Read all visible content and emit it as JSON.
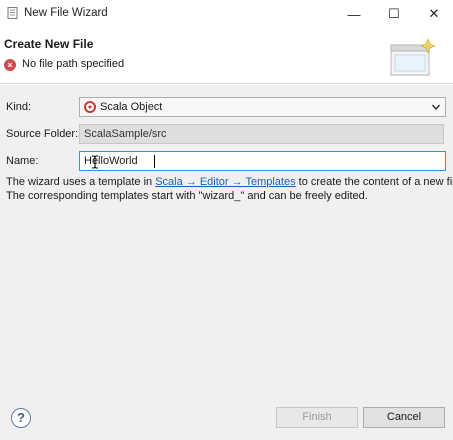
{
  "window": {
    "title": "New File Wizard",
    "minimize_glyph": "—",
    "maximize_glyph": "☐",
    "close_glyph": "✕"
  },
  "header": {
    "title": "Create New File",
    "error_glyph": "×",
    "error_message": "No file path specified"
  },
  "form": {
    "kind_label": "Kind:",
    "kind_value": "Scala Object",
    "source_folder_label": "Source Folder:",
    "source_folder_value": "ScalaSample/src",
    "name_label": "Name:",
    "name_value": "HelloWorld"
  },
  "info": {
    "line1_prefix": "The wizard uses a template in ",
    "line1_link": "Scala → Editor → Templates",
    "line1_suffix": " to create the content of a new file.",
    "line2": "The corresponding templates start with \"wizard_\" and can be freely edited."
  },
  "footer": {
    "help_glyph": "?",
    "finish_label": "Finish",
    "cancel_label": "Cancel"
  }
}
